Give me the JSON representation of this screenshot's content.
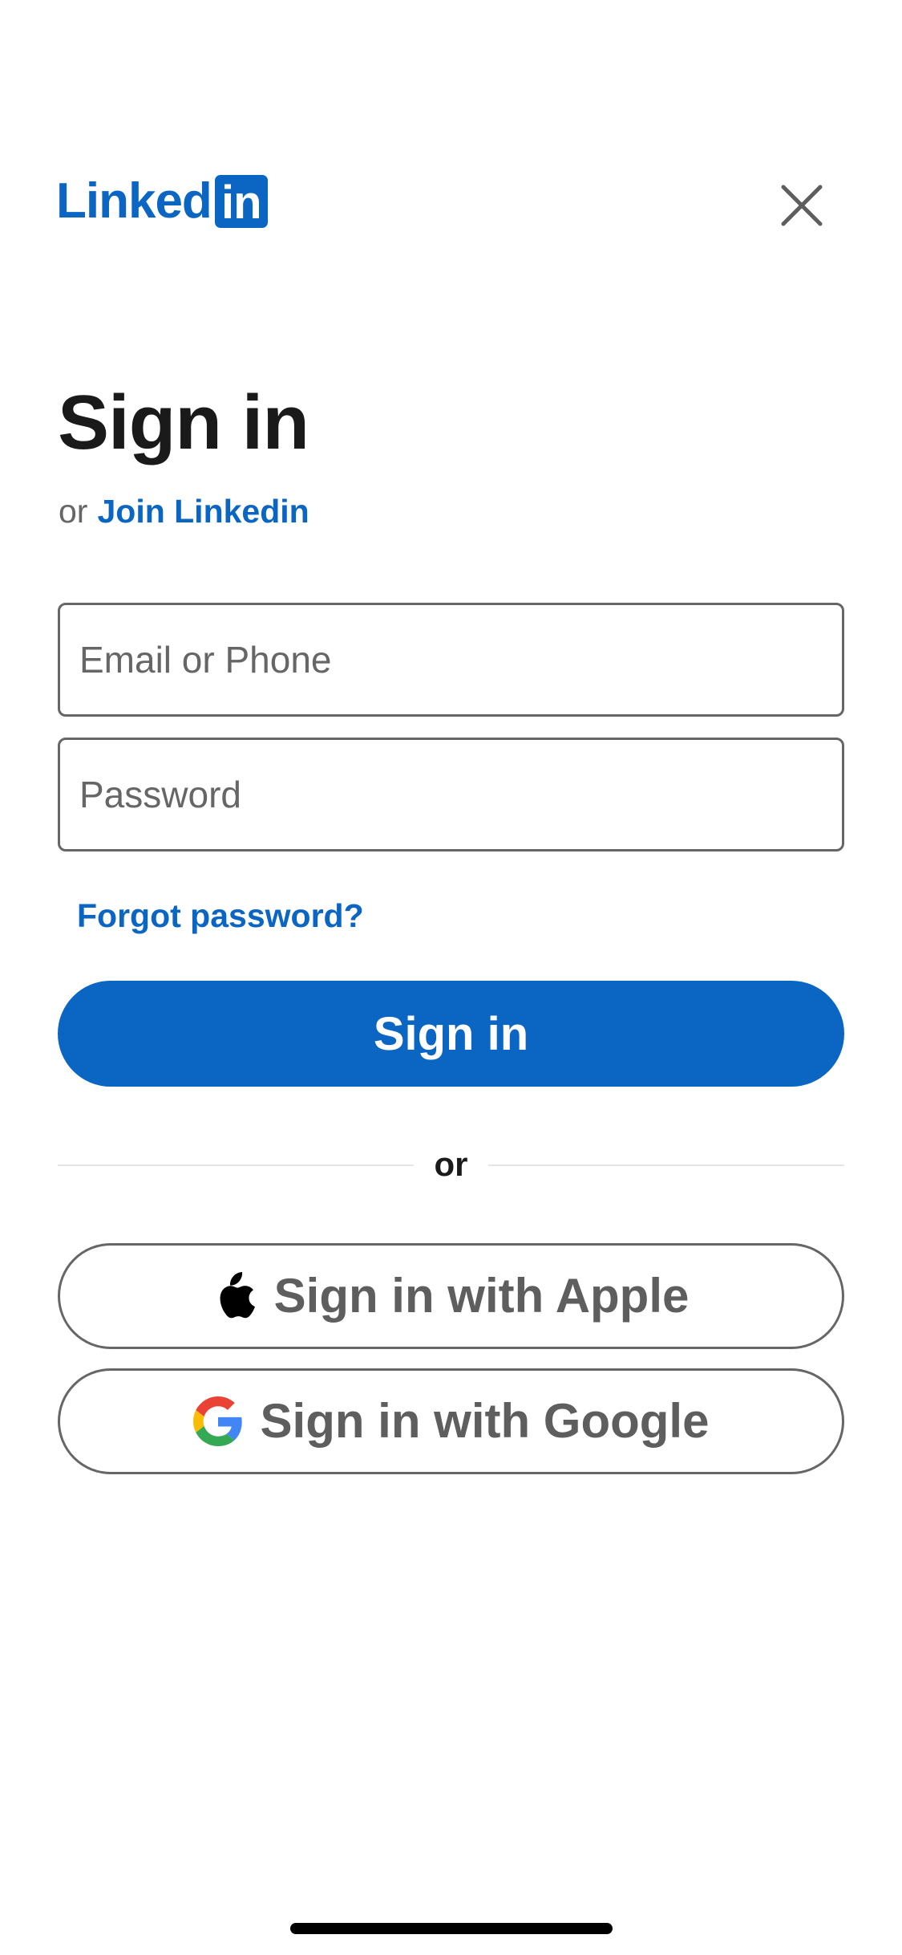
{
  "header": {
    "logo_word": "Linked",
    "logo_box": "in",
    "close_icon": "close-icon"
  },
  "title": "Sign in",
  "join": {
    "prefix": "or",
    "link_label": "Join Linkedin"
  },
  "form": {
    "email_placeholder": "Email or Phone",
    "email_value": "",
    "password_placeholder": "Password",
    "password_value": "",
    "forgot_label": "Forgot password?",
    "submit_label": "Sign in"
  },
  "divider_label": "or",
  "social": {
    "apple": {
      "label": "Sign in with Apple",
      "icon": "apple-icon"
    },
    "google": {
      "label": "Sign in with Google",
      "icon": "google-icon"
    }
  },
  "colors": {
    "brand_blue": "#0a66c2",
    "border_gray": "#666666",
    "text_dark": "#1a1a1a",
    "divider": "#e4e4e4"
  }
}
